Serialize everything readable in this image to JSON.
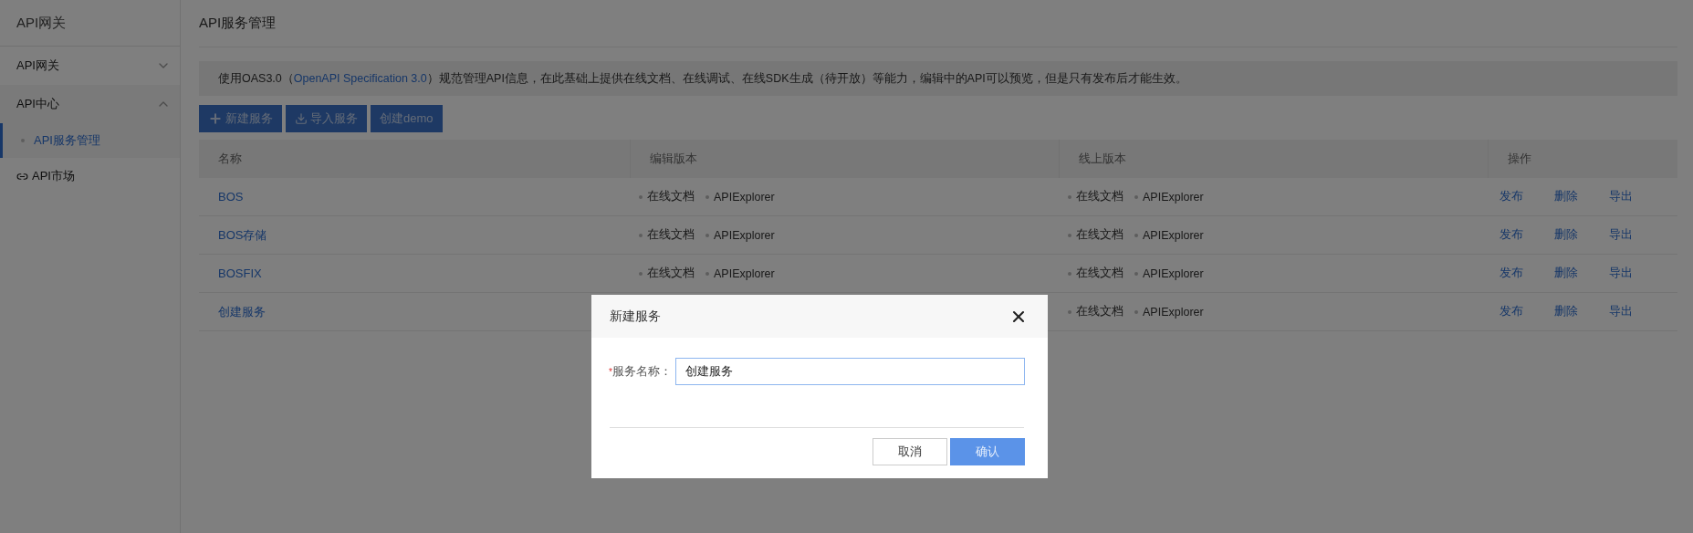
{
  "sidebar": {
    "title": "API网关",
    "items": [
      {
        "kind": "group",
        "label": "API网关",
        "expanded": false
      },
      {
        "kind": "group",
        "label": "API中心",
        "expanded": true,
        "children": [
          {
            "label": "API服务管理",
            "selected": true
          }
        ]
      },
      {
        "kind": "link",
        "label": "API市场",
        "selected": false
      }
    ]
  },
  "page": {
    "title": "API服务管理",
    "notice": {
      "before": "使用OAS3.0（",
      "link": "OpenAPI Specification 3.0",
      "after": "）规范管理API信息，在此基础上提供在线文档、在线调试、在线SDK生成（待开放）等能力，编辑中的API可以预览，但是只有发布后才能生效。"
    },
    "toolbar": [
      {
        "kind": "add",
        "label": "新建服务"
      },
      {
        "kind": "import",
        "label": "导入服务"
      },
      {
        "kind": "plain",
        "label": "创建demo"
      }
    ],
    "table": {
      "columns": [
        "名称",
        "编辑版本",
        "线上版本",
        "操作"
      ],
      "rows": [
        {
          "name": "BOS",
          "edit": [
            "在线文档",
            "APIExplorer"
          ],
          "online": [
            "在线文档",
            "APIExplorer"
          ],
          "actions": [
            "发布",
            "删除",
            "导出"
          ]
        },
        {
          "name": "BOS存储",
          "edit": [
            "在线文档",
            "APIExplorer"
          ],
          "online": [
            "在线文档",
            "APIExplorer"
          ],
          "actions": [
            "发布",
            "删除",
            "导出"
          ]
        },
        {
          "name": "BOSFIX",
          "edit": [
            "在线文档",
            "APIExplorer"
          ],
          "online": [
            "在线文档",
            "APIExplorer"
          ],
          "actions": [
            "发布",
            "删除",
            "导出"
          ]
        },
        {
          "name": "创建服务",
          "online": [
            "在线文档",
            "APIExplorer"
          ],
          "actions": [
            "发布",
            "删除",
            "导出"
          ]
        }
      ]
    }
  },
  "dialog": {
    "title": "新建服务",
    "field": {
      "required_mark": "*",
      "label": "服务名称：",
      "value": "创建服务"
    },
    "buttons": [
      {
        "kind": "secondary",
        "label": "取消"
      },
      {
        "kind": "primary",
        "label": "确认"
      }
    ]
  }
}
